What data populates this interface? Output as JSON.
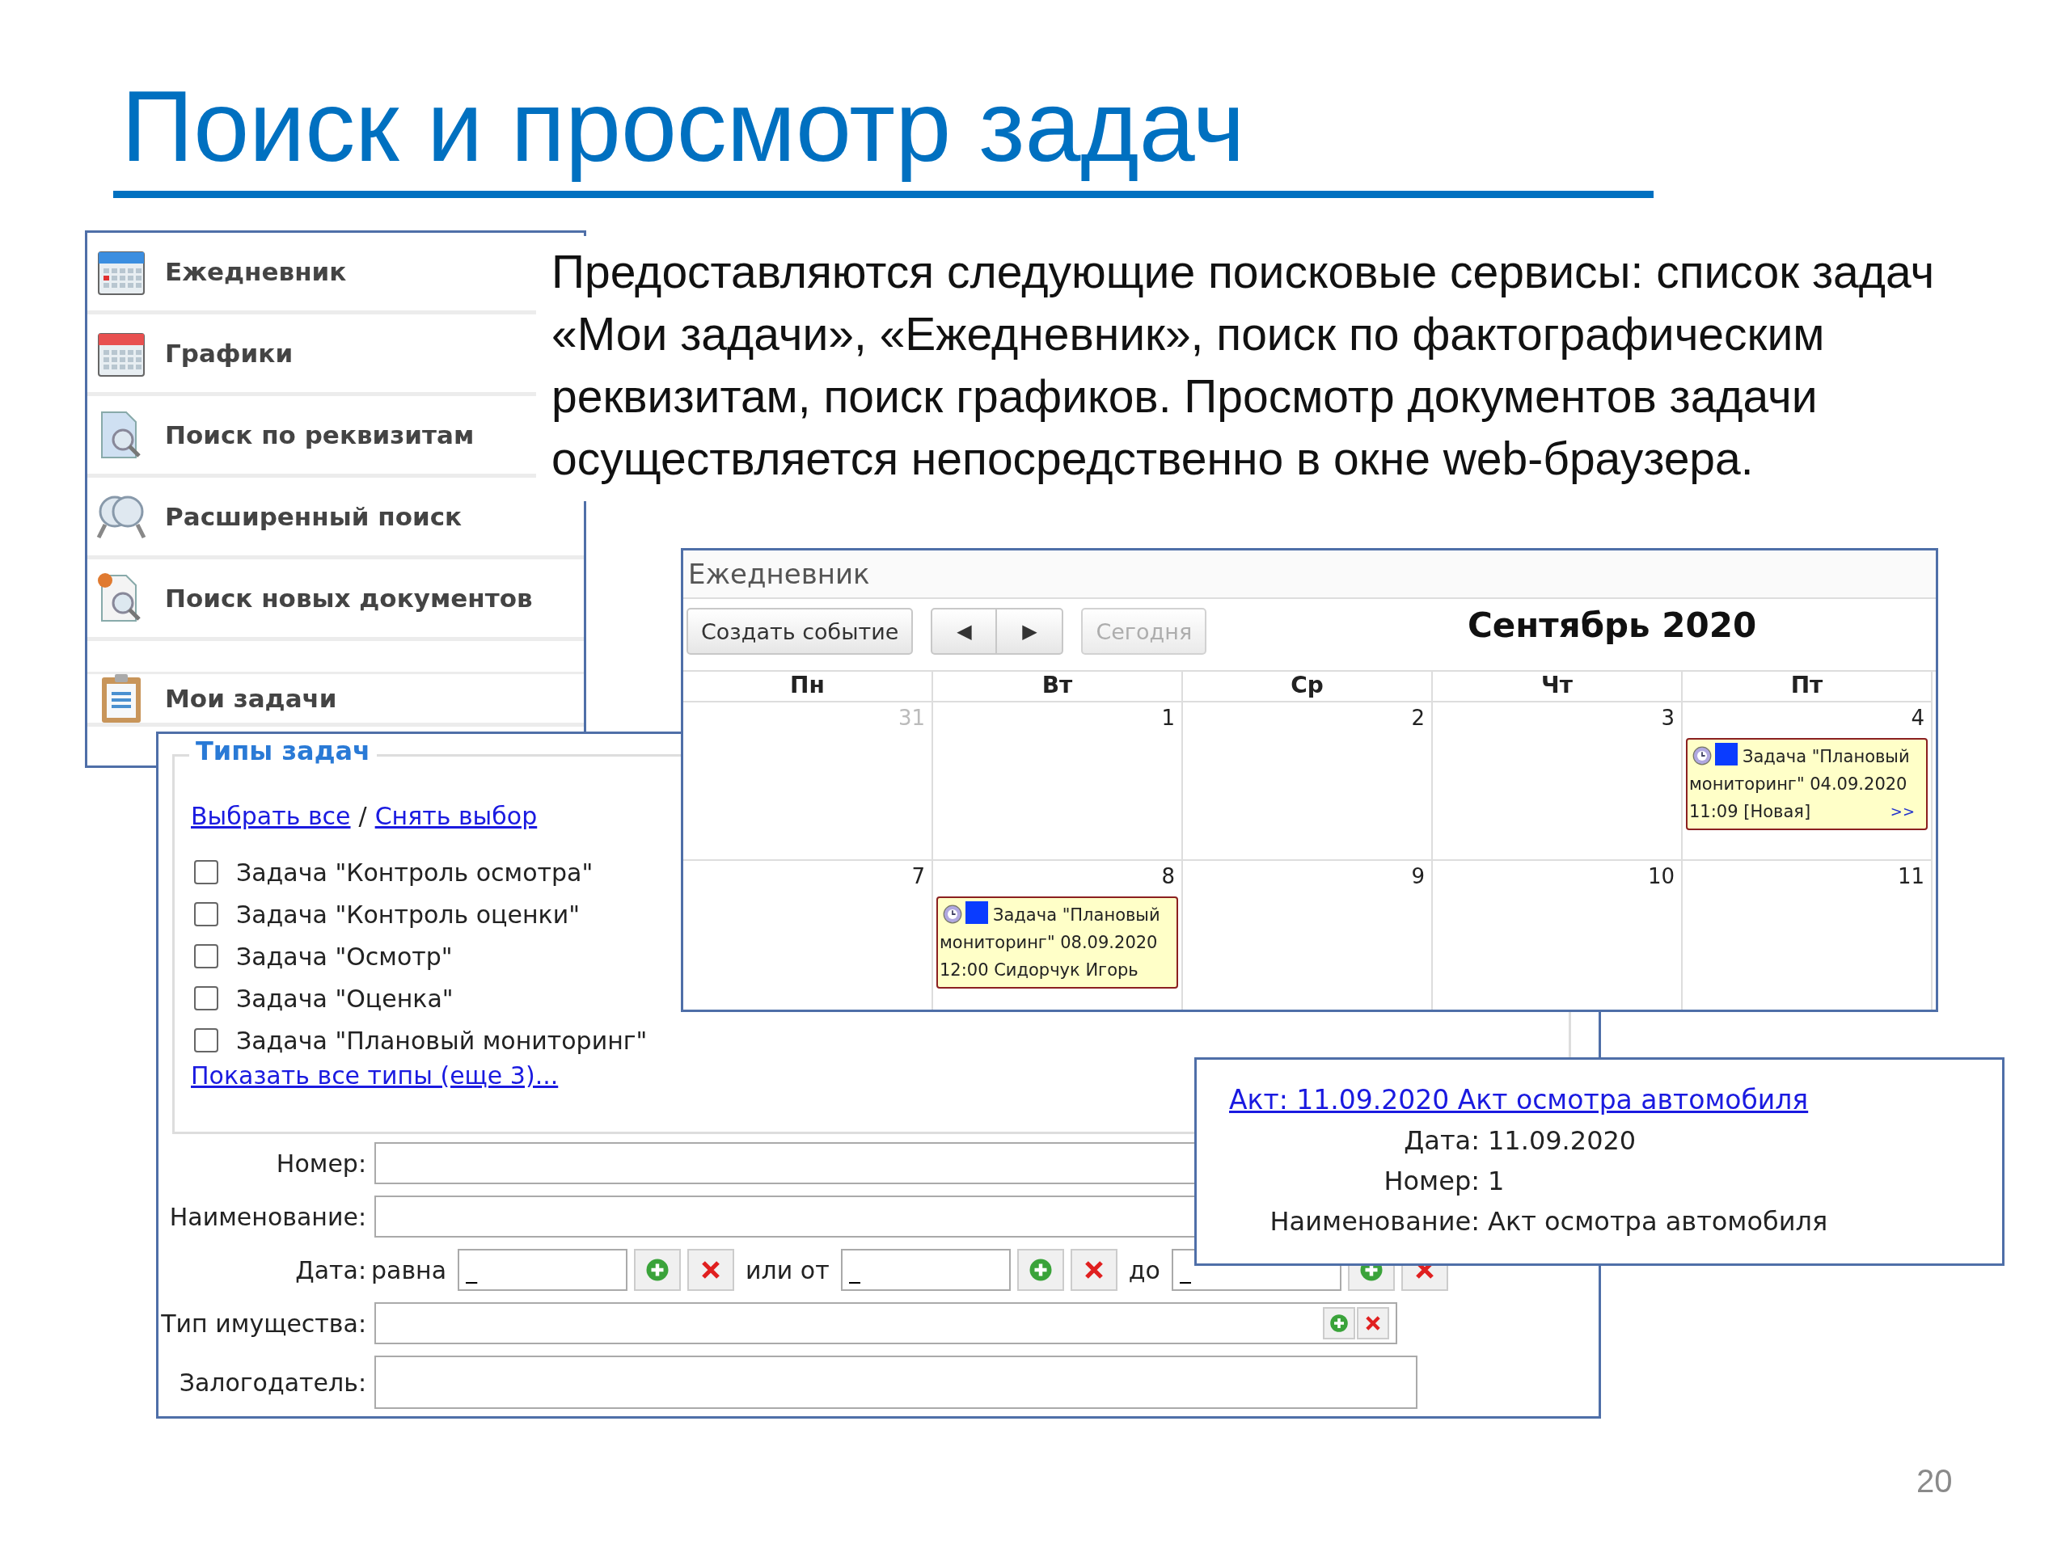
{
  "title": "Поиск и просмотр задач",
  "description": "Предоставляются следующие поисковые сервисы: список задач «Мои задачи», «Ежедневник», поиск по фактографическим реквизитам, поиск графиков. Просмотр документов задачи осуществляется непосредственно в окне web-браузера.",
  "sidebar": {
    "items": [
      {
        "kind": "diary",
        "label": "Ежедневник",
        "gap_before": false
      },
      {
        "kind": "schedule",
        "label": "Графики",
        "gap_before": false
      },
      {
        "kind": "doc-search",
        "label": "Поиск по реквизитам",
        "gap_before": false
      },
      {
        "kind": "advanced-search",
        "label": "Расширенный поиск",
        "gap_before": false
      },
      {
        "kind": "new-docs",
        "label": "Поиск новых документов",
        "gap_before": false
      },
      {
        "kind": "tasks",
        "label": "Мои задачи",
        "gap_before": true
      }
    ]
  },
  "calendar": {
    "title": "Ежедневник",
    "create_button": "Создать событие",
    "prev": "◀",
    "next": "▶",
    "today": {
      "label": "Сегодня",
      "disabled": true
    },
    "month": "Сентябрь 2020",
    "weekdays": [
      "Пн",
      "Вт",
      "Ср",
      "Чт",
      "Пт"
    ],
    "weeks": [
      [
        {
          "day": "31",
          "other_month": true
        },
        {
          "day": "1",
          "other_month": false
        },
        {
          "day": "2",
          "other_month": false
        },
        {
          "day": "3",
          "other_month": false
        },
        {
          "day": "4",
          "other_month": false,
          "events": [
            {
              "text": "Задача \"Плановый мониторинг\" 04.09.2020 11:09 [Новая]",
              "more": ">>",
              "color": "#0a3cff"
            }
          ]
        }
      ],
      [
        {
          "day": "7",
          "other_month": false
        },
        {
          "day": "8",
          "other_month": false,
          "events": [
            {
              "text": "Задача \"Плановый мониторинг\" 08.09.2020 12:00 Сидорчук Игорь",
              "color": "#0a3cff"
            }
          ]
        },
        {
          "day": "9",
          "other_month": false
        },
        {
          "day": "10",
          "other_month": false
        },
        {
          "day": "11",
          "other_month": false
        }
      ]
    ]
  },
  "task_types": {
    "legend": "Типы задач",
    "select_all": "Выбрать все",
    "separator": "/",
    "deselect_all": "Снять выбор",
    "types": [
      {
        "label": "Задача \"Контроль осмотра\"",
        "checked": false
      },
      {
        "label": "Задача \"Контроль оценки\"",
        "checked": false
      },
      {
        "label": "Задача \"Осмотр\"",
        "checked": false
      },
      {
        "label": "Задача \"Оценка\"",
        "checked": false
      },
      {
        "label": "Задача \"Плановый мониторинг\"",
        "checked": false
      }
    ],
    "show_all": "Показать все типы (еще 3)..."
  },
  "form": {
    "fields": [
      {
        "kind": "text",
        "label": "Номер:"
      },
      {
        "kind": "text",
        "label": "Наименование:"
      },
      {
        "kind": "date",
        "label": "Дата:",
        "equal_label": "равна",
        "equal_value": "_",
        "from_label": "или от",
        "from_value": "_",
        "to_label": "до",
        "to_value": "_"
      },
      {
        "kind": "picker",
        "label": "Тип имущества:"
      },
      {
        "kind": "tall",
        "label": "Залогодатель:"
      }
    ]
  },
  "popup": {
    "link": "Акт: 11.09.2020 Акт осмотра автомобиля",
    "rows": [
      {
        "label": "Дата:",
        "value": "11.09.2020"
      },
      {
        "label": "Номер:",
        "value": "1"
      },
      {
        "label": "Наименование:",
        "value": "Акт осмотра автомобиля"
      }
    ]
  },
  "page_number": "20"
}
